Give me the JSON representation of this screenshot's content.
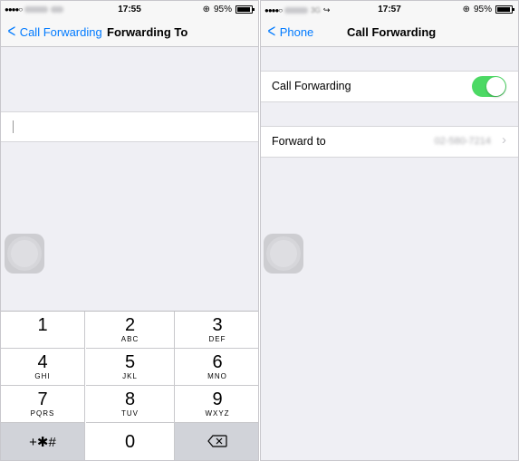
{
  "left_screen": {
    "status": {
      "time": "17:55",
      "battery": "95%"
    },
    "nav": {
      "back_label": "Call Forwarding",
      "title": "Forwarding To"
    },
    "input": {
      "value": ""
    },
    "keypad": [
      {
        "digit": "1",
        "letters": ""
      },
      {
        "digit": "2",
        "letters": "ABC"
      },
      {
        "digit": "3",
        "letters": "DEF"
      },
      {
        "digit": "4",
        "letters": "GHI"
      },
      {
        "digit": "5",
        "letters": "JKL"
      },
      {
        "digit": "6",
        "letters": "MNO"
      },
      {
        "digit": "7",
        "letters": "PQRS"
      },
      {
        "digit": "8",
        "letters": "TUV"
      },
      {
        "digit": "9",
        "letters": "WXYZ"
      },
      {
        "digit": "+✱#",
        "letters": ""
      },
      {
        "digit": "0",
        "letters": ""
      }
    ]
  },
  "right_screen": {
    "status": {
      "time": "17:57",
      "battery": "95%",
      "network": "3G"
    },
    "nav": {
      "back_label": "Phone",
      "title": "Call Forwarding"
    },
    "call_forwarding": {
      "label": "Call Forwarding",
      "enabled": true
    },
    "forward_to": {
      "label": "Forward to",
      "value": "02-580-7214"
    }
  },
  "colors": {
    "accent": "#007aff",
    "toggle_on": "#4cd964",
    "background": "#efeff4"
  }
}
